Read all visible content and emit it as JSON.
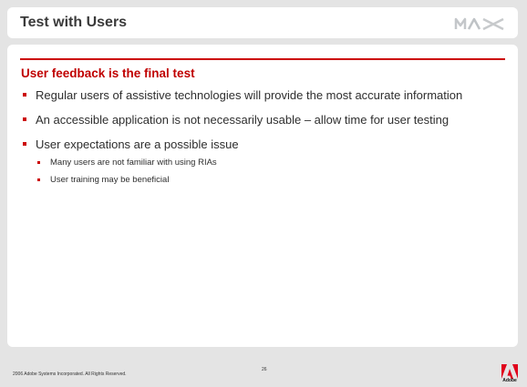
{
  "slide": {
    "title": "Test with Users",
    "logo": "MAX",
    "heading": "User feedback is the final test",
    "bullets": [
      "Regular users of assistive technologies will provide the most accurate information",
      "An accessible application is not necessarily usable – allow time for user testing",
      "User expectations are a possible issue"
    ],
    "sub_bullets": [
      "Many users are not familiar with using RIAs",
      "User training may be beneficial"
    ]
  },
  "footer": {
    "copyright": "2006 Adobe Systems Incorporated.  All Rights Reserved.",
    "page_number": "26",
    "adobe_label": "Adobe"
  },
  "colors": {
    "accent": "#cc0000",
    "background": "#e4e4e4"
  }
}
